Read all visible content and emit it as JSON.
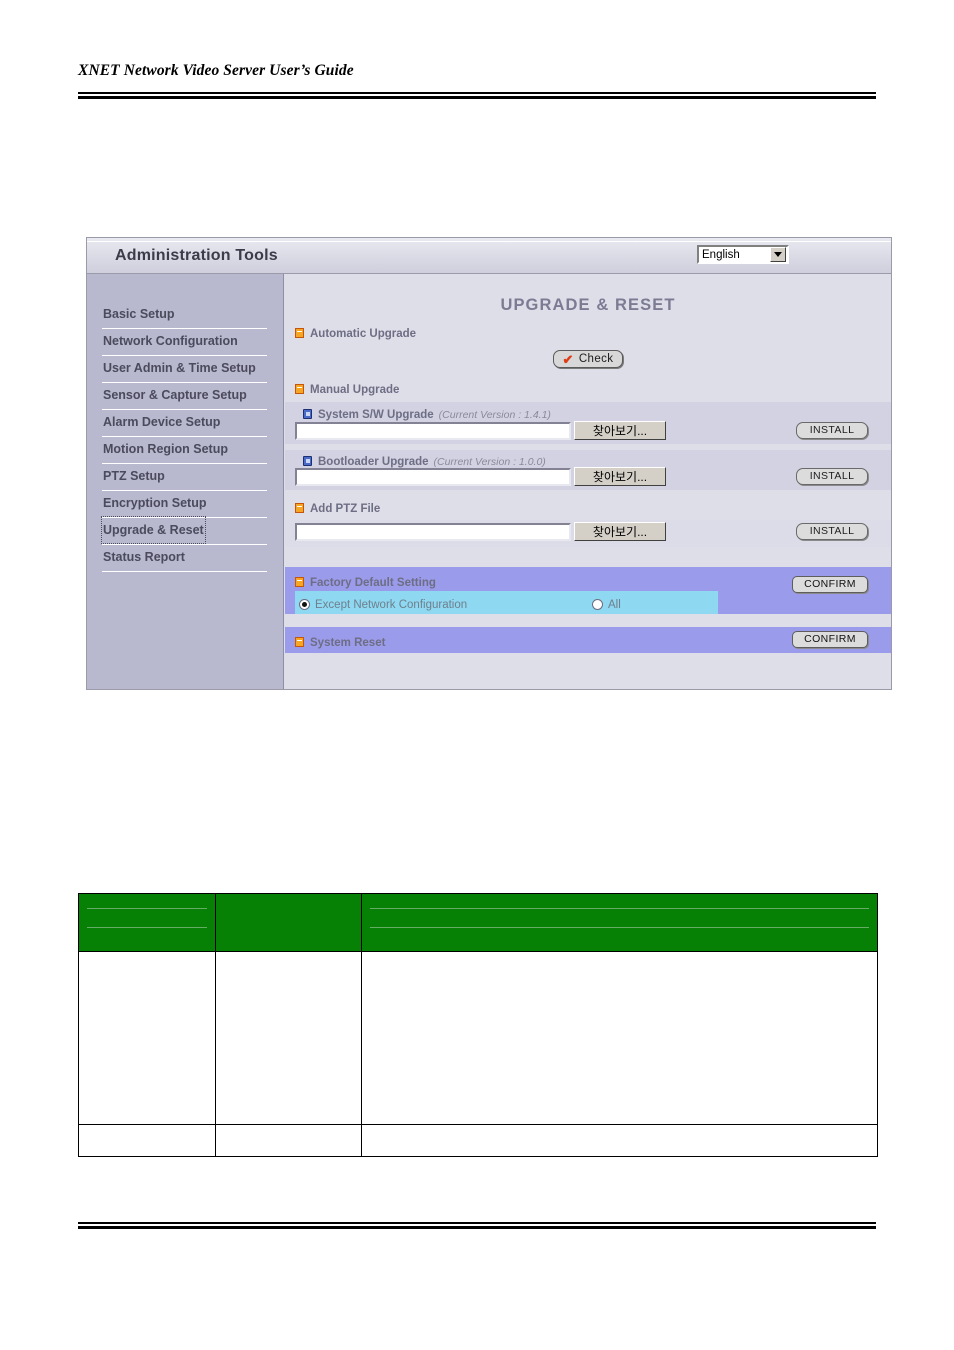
{
  "document": {
    "header_title": "XNET Network Video Server User’s Guide"
  },
  "app": {
    "titlebar": {
      "title": "Administration Tools",
      "language_value": "English",
      "dropdown_icon": "chevron-down-icon"
    },
    "sidebar": {
      "items": [
        {
          "label": "Basic Setup",
          "active": false
        },
        {
          "label": "Network Configuration",
          "active": false
        },
        {
          "label": "User Admin & Time Setup",
          "active": false
        },
        {
          "label": "Sensor & Capture Setup",
          "active": false
        },
        {
          "label": "Alarm Device Setup",
          "active": false
        },
        {
          "label": "Motion Region Setup",
          "active": false
        },
        {
          "label": "PTZ Setup",
          "active": false
        },
        {
          "label": "Encryption Setup",
          "active": false
        },
        {
          "label": "Upgrade & Reset",
          "active": true
        },
        {
          "label": "Status Report",
          "active": false
        }
      ]
    },
    "main": {
      "page_title": "UPGRADE & RESET",
      "automatic_upgrade": {
        "label": "Automatic Upgrade",
        "check_button": "Check",
        "check_mark": "✔"
      },
      "manual_upgrade": {
        "label": "Manual Upgrade",
        "system_sw": {
          "label": "System S/W Upgrade",
          "version": "(Current Version : 1.4.1)",
          "input_value": "",
          "browse_label": "찾아보기...",
          "install_label": "INSTALL"
        },
        "bootloader": {
          "label": "Bootloader Upgrade",
          "version": "(Current Version : 1.0.0)",
          "input_value": "",
          "browse_label": "찾아보기...",
          "install_label": "INSTALL"
        }
      },
      "add_ptz_file": {
        "label": "Add PTZ File",
        "input_value": "",
        "browse_label": "찾아보기...",
        "install_label": "INSTALL"
      },
      "factory_default": {
        "label": "Factory Default Setting",
        "confirm_label": "CONFIRM",
        "options": [
          {
            "label": "Except Network Configuration",
            "selected": true
          },
          {
            "label": "All",
            "selected": false
          }
        ]
      },
      "system_reset": {
        "label": "System Reset",
        "confirm_label": "CONFIRM"
      }
    }
  },
  "table": {
    "header_cells": [
      "",
      "",
      ""
    ],
    "rows": [
      [
        "",
        "",
        ""
      ],
      [
        "",
        "",
        ""
      ]
    ]
  },
  "colors": {
    "sidebar_bg": "#b8b8cf",
    "content_bg": "#dedee9",
    "periwinkle_band": "#9b9bec",
    "cyan_band": "#8ed8f2",
    "table_header_green": "#068005",
    "check_mark_red": "#e03c14",
    "bullet_orange": "#f5a623",
    "bullet_blue": "#4a6bc8"
  }
}
